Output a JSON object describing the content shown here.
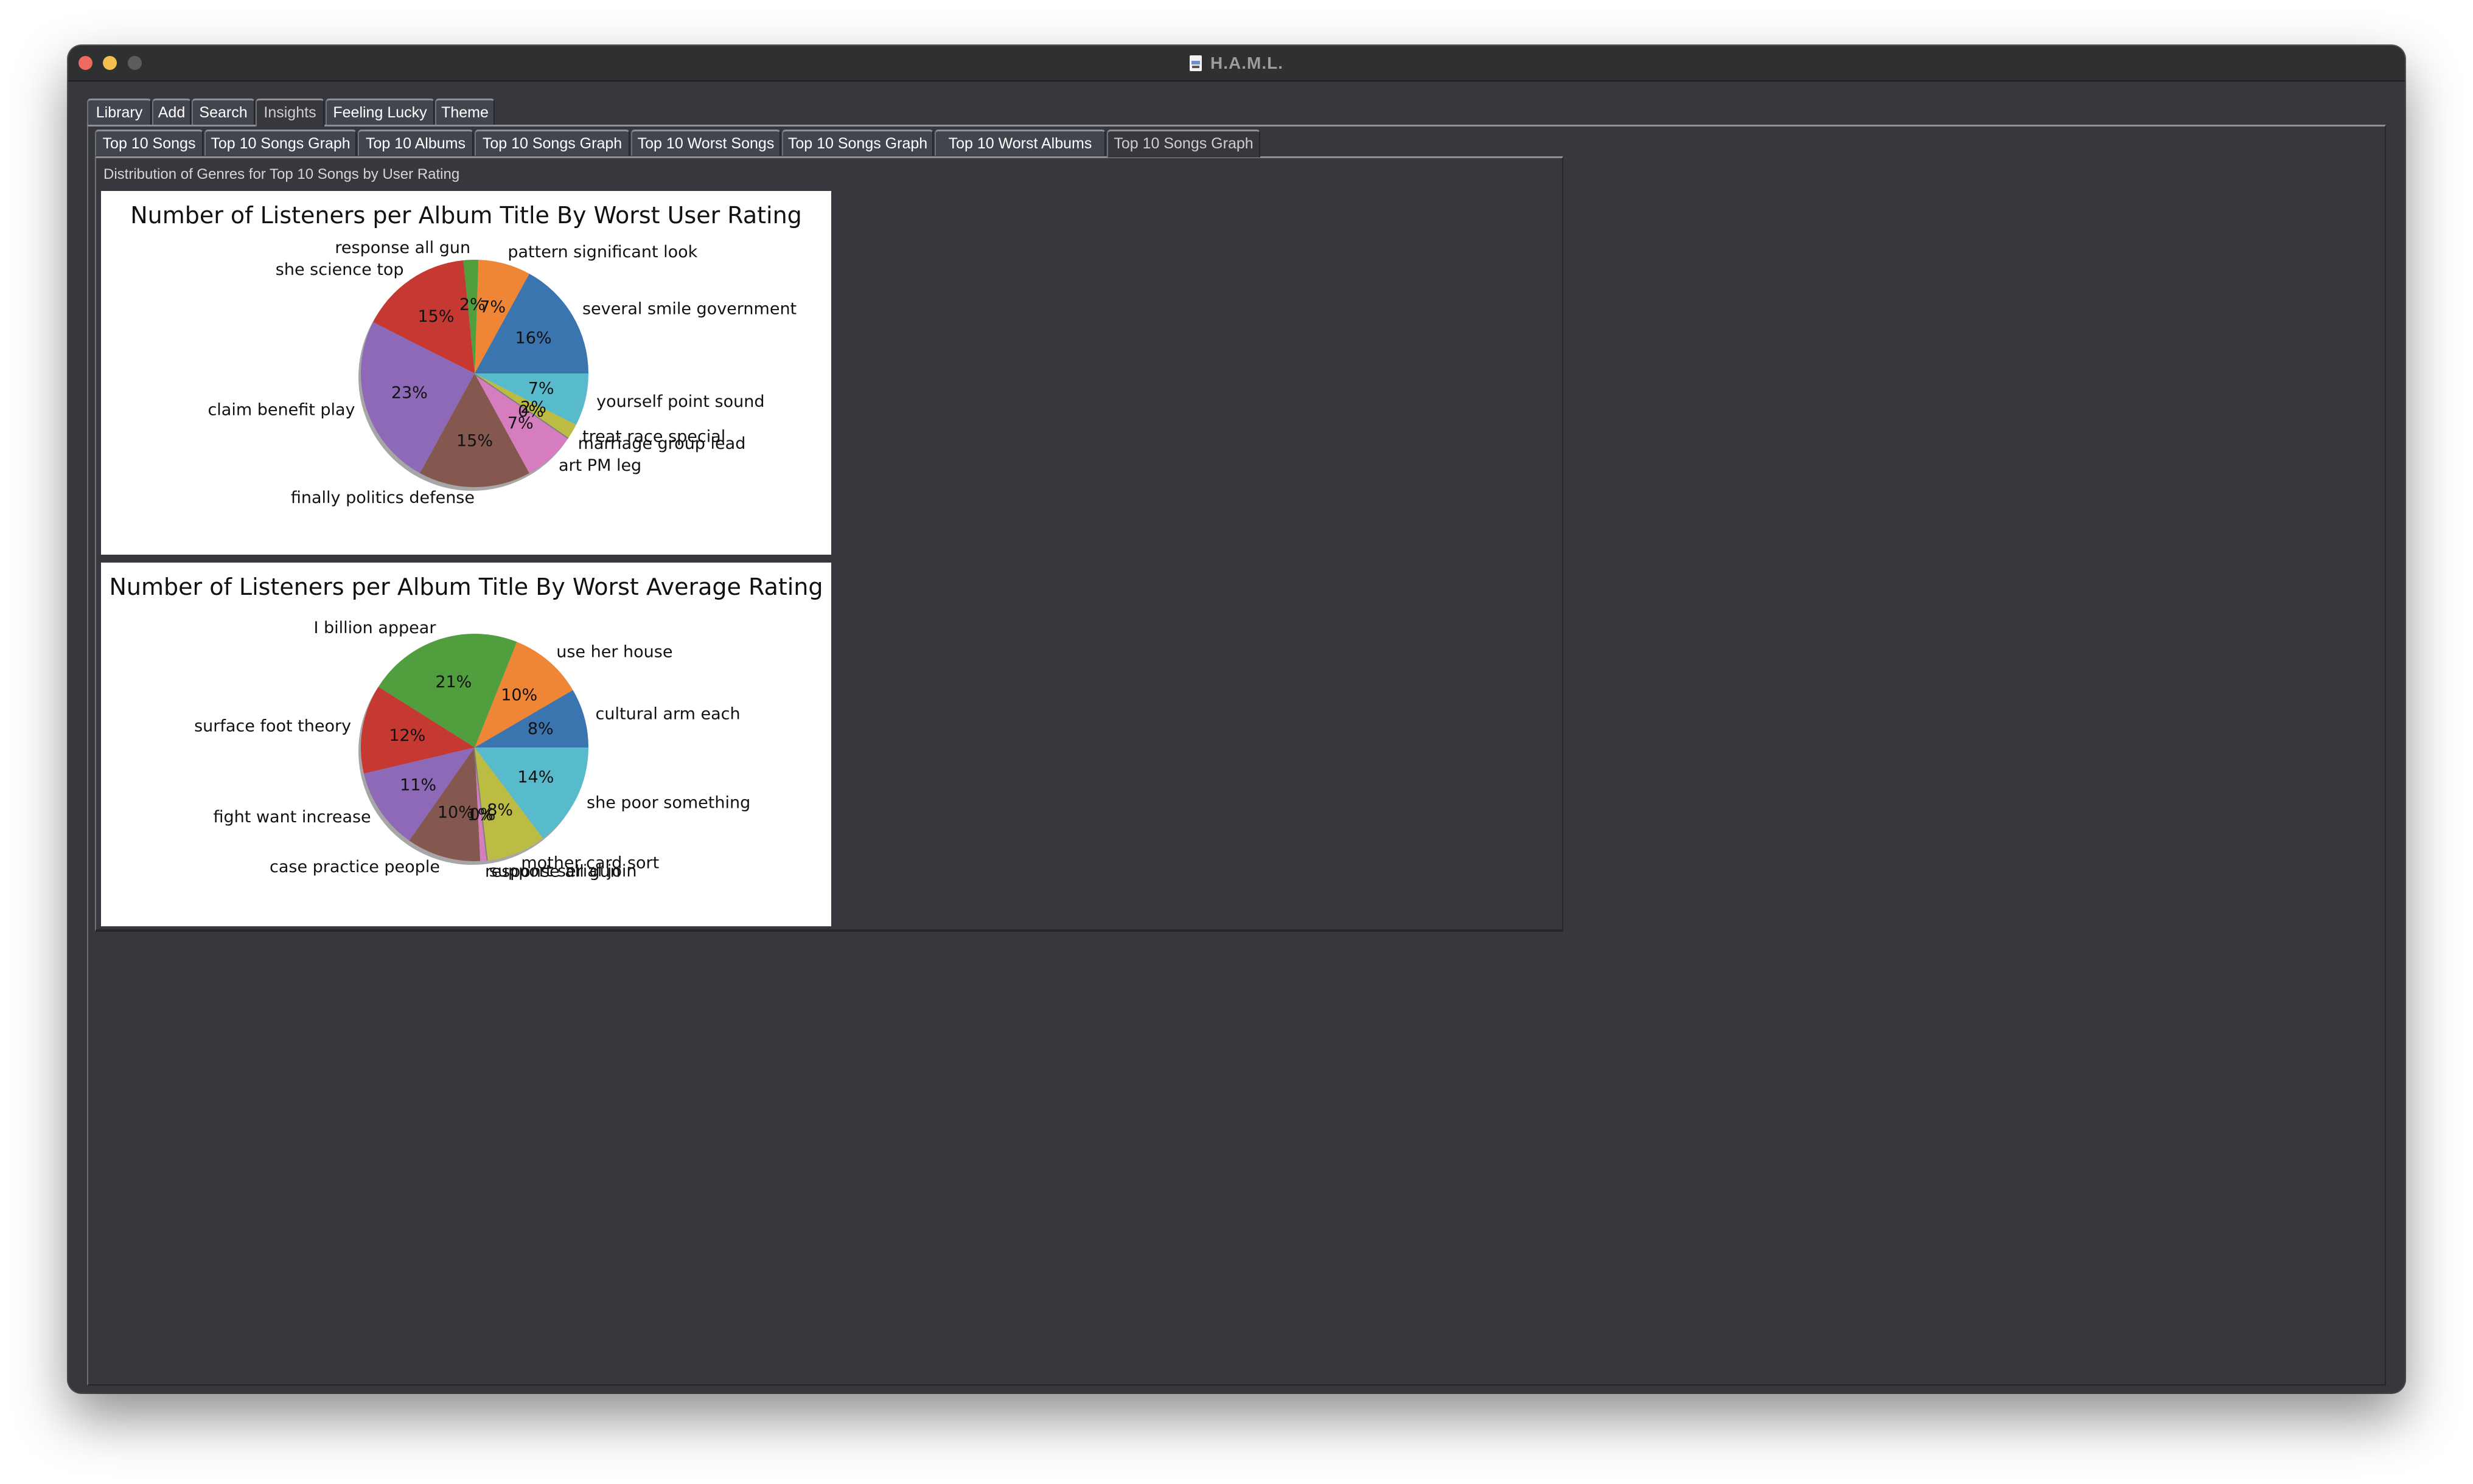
{
  "window": {
    "title": "H.A.M.L.",
    "title_icon": "document-icon"
  },
  "outer_tabs": [
    {
      "label": "Library",
      "selected": false
    },
    {
      "label": "Add",
      "selected": false
    },
    {
      "label": "Search",
      "selected": false
    },
    {
      "label": "Insights",
      "selected": true
    },
    {
      "label": "Feeling Lucky",
      "selected": false
    },
    {
      "label": "Theme",
      "selected": false
    }
  ],
  "inner_tabs": [
    {
      "label": "Top 10 Songs",
      "selected": false
    },
    {
      "label": "Top 10 Songs Graph",
      "selected": false
    },
    {
      "label": "Top 10 Albums",
      "selected": false
    },
    {
      "label": "Top 10 Songs Graph",
      "selected": false
    },
    {
      "label": "Top 10 Worst Songs",
      "selected": false
    },
    {
      "label": "Top 10 Songs Graph",
      "selected": false
    },
    {
      "label": "Top 10 Worst Albums",
      "selected": false
    },
    {
      "label": "Top 10 Songs Graph",
      "selected": true
    }
  ],
  "panel": {
    "label": "Distribution of Genres for Top 10 Songs by User Rating"
  },
  "colors": {
    "slice_palette": [
      "#3a75af",
      "#ef8636",
      "#519e3e",
      "#c53932",
      "#8d69b8",
      "#84584e",
      "#d57dbe",
      "#7f7f7f",
      "#bcbc45",
      "#58bbcc"
    ]
  },
  "chart_data": [
    {
      "type": "pie",
      "title": "Number of Listeners per Album Title By Worst User Rating",
      "start_angle": 0,
      "shadow": true,
      "labels": [
        "several smile government",
        "pattern significant look",
        "response all gun",
        "she science top",
        "claim benefit play",
        "finally politics defense",
        "art PM leg",
        "marriage group lead",
        "treat race special",
        "yourself point sound"
      ],
      "values": [
        16,
        7,
        2,
        15,
        23,
        15,
        7,
        0,
        2,
        7
      ],
      "percent_labels": [
        "16%",
        "7%",
        "2%",
        "15%",
        "23%",
        "15%",
        "7%",
        "0%",
        "2%",
        "7%"
      ]
    },
    {
      "type": "pie",
      "title": "Number of Listeners per Album Title By Worst Average Rating",
      "start_angle": 0,
      "shadow": true,
      "labels": [
        "cultural arm each",
        "use her house",
        "I billion appear",
        "surface foot theory",
        "fight want increase",
        "case practice people",
        "response all gun",
        "support serial join",
        "mother card sort",
        "she poor something"
      ],
      "values": [
        8,
        10,
        21,
        12,
        11,
        10,
        1,
        0,
        8,
        14
      ],
      "percent_labels": [
        "8%",
        "10%",
        "21%",
        "12%",
        "11%",
        "10%",
        "1%",
        "0%",
        "8%",
        "14%"
      ]
    }
  ]
}
